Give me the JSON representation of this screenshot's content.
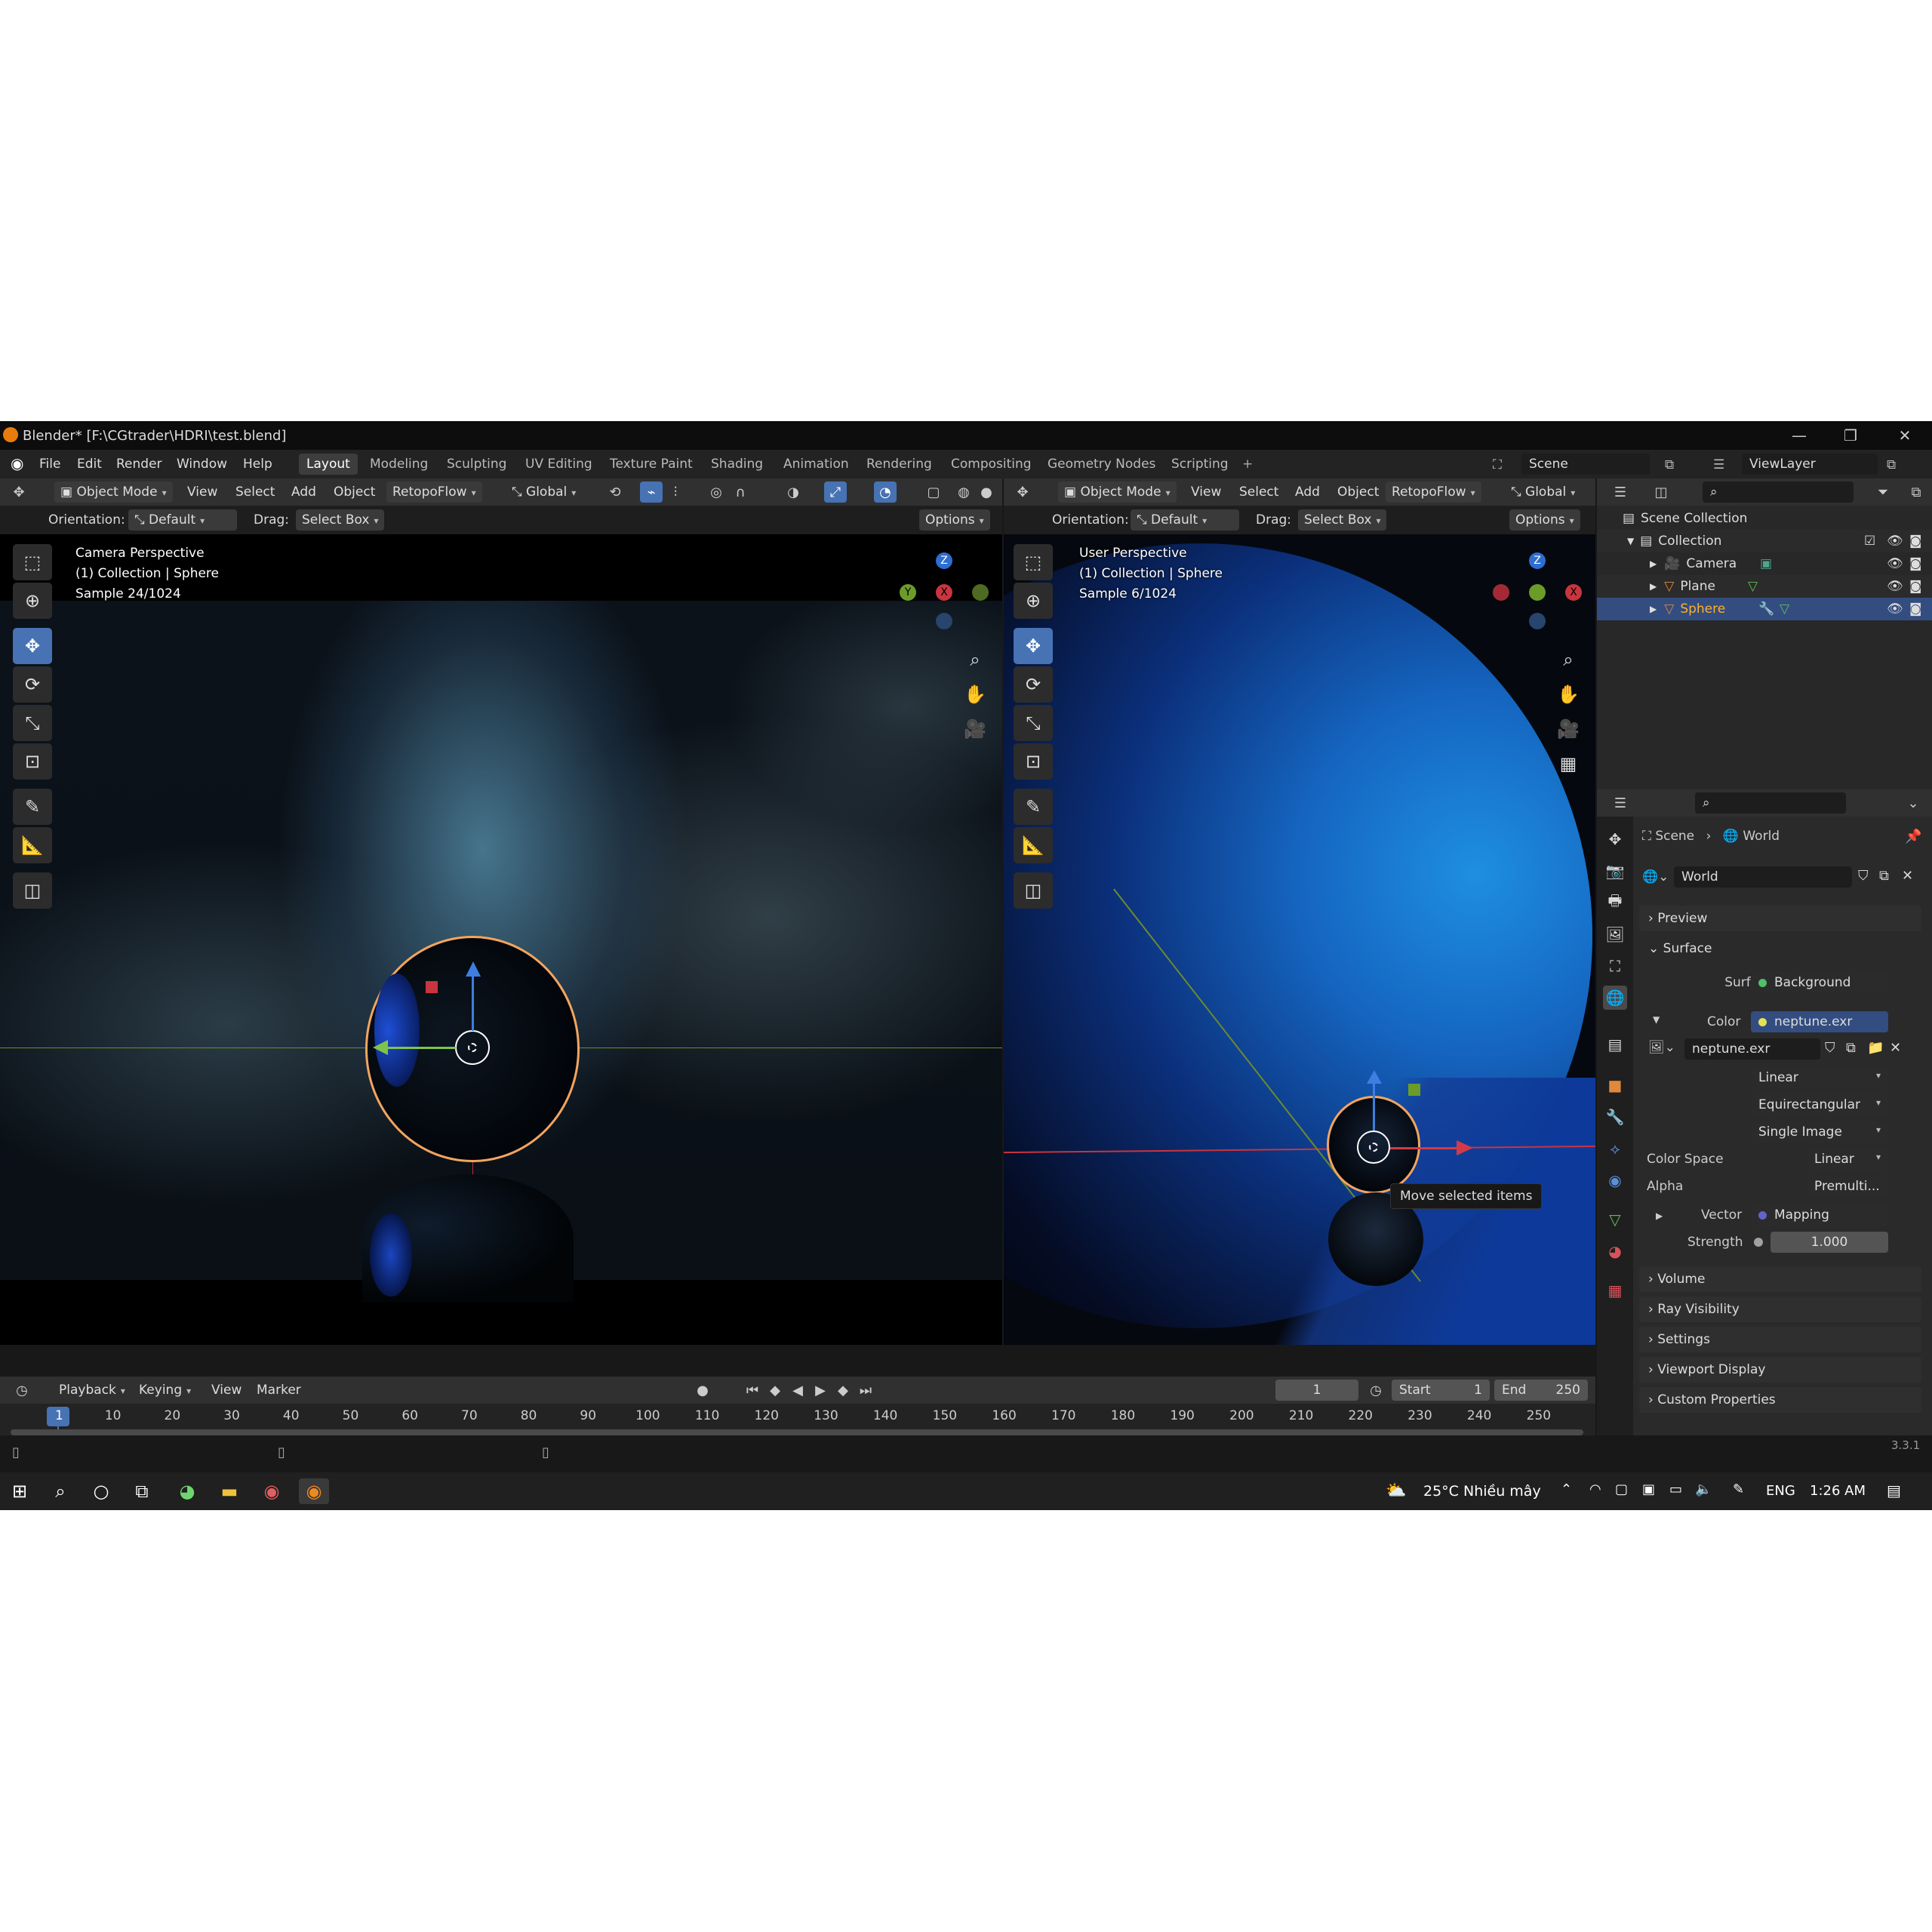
{
  "window": {
    "title": "Blender* [F:\\CGtrader\\HDRI\\test.blend]"
  },
  "menu": [
    "File",
    "Edit",
    "Render",
    "Window",
    "Help"
  ],
  "workspaces": [
    "Layout",
    "Modeling",
    "Sculpting",
    "UV Editing",
    "Texture Paint",
    "Shading",
    "Animation",
    "Rendering",
    "Compositing",
    "Geometry Nodes",
    "Scripting"
  ],
  "active_workspace": "Layout",
  "scene_selector": {
    "label": "Scene",
    "viewlayer": "ViewLayer"
  },
  "left_viewport": {
    "mode": "Object Mode",
    "menus": [
      "View",
      "Select",
      "Add",
      "Object"
    ],
    "addon": "RetopoFlow",
    "transform": "Global",
    "orientation_label": "Orientation:",
    "orientation": "Default",
    "drag_label": "Drag:",
    "drag": "Select Box",
    "options": "Options",
    "overlay": [
      "Camera Perspective",
      "(1) Collection | Sphere",
      "Sample 24/1024"
    ]
  },
  "right_viewport": {
    "mode": "Object Mode",
    "menus": [
      "View",
      "Select",
      "Add",
      "Object"
    ],
    "addon": "RetopoFlow",
    "transform": "Global",
    "orientation_label": "Orientation:",
    "orientation": "Default",
    "drag_label": "Drag:",
    "drag": "Select Box",
    "options": "Options",
    "overlay": [
      "User Perspective",
      "(1) Collection | Sphere",
      "Sample 6/1024"
    ],
    "tooltip": "Move selected items"
  },
  "gizmo_axes": {
    "x": "X",
    "y": "Y",
    "z": "Z",
    "x_color": "#c8353f",
    "y_color": "#6b9c2a",
    "z_color": "#2e6dd1"
  },
  "outliner": {
    "root": "Scene Collection",
    "collection": "Collection",
    "items": [
      "Camera",
      "Plane",
      "Sphere"
    ],
    "selected": "Sphere"
  },
  "properties": {
    "breadcrumb": [
      "Scene",
      "World"
    ],
    "datablock": "World",
    "panels_top": [
      "Preview",
      "Surface"
    ],
    "surface_label": "Surface",
    "surface_value": "Background",
    "color_label": "Color",
    "color_value": "neptune.exr",
    "image_name": "neptune.exr",
    "interp": "Linear",
    "projection": "Equirectangular",
    "source": "Single Image",
    "color_space_label": "Color Space",
    "color_space": "Linear",
    "alpha_label": "Alpha",
    "alpha": "Premulti...",
    "vector_label": "Vector",
    "vector": "Mapping",
    "strength_label": "Strength",
    "strength": "1.000",
    "panels_bottom": [
      "Volume",
      "Ray Visibility",
      "Settings",
      "Viewport Display",
      "Custom Properties"
    ]
  },
  "timeline": {
    "menus": [
      "Playback",
      "Keying",
      "View",
      "Marker"
    ],
    "current_frame": "1",
    "start_label": "Start",
    "start": "1",
    "end_label": "End",
    "end": "250",
    "ticks": [
      "1",
      "10",
      "20",
      "30",
      "40",
      "50",
      "60",
      "70",
      "80",
      "90",
      "100",
      "110",
      "120",
      "130",
      "140",
      "150",
      "160",
      "170",
      "180",
      "190",
      "200",
      "210",
      "220",
      "230",
      "240",
      "250"
    ]
  },
  "version": "3.3.1",
  "taskbar": {
    "weather": "25°C  Nhiều mây",
    "lang": "ENG",
    "time": "1:26 AM"
  },
  "colors": {
    "accent": "#4772b3",
    "selection": "#ff9f43",
    "bg": "#181818"
  }
}
